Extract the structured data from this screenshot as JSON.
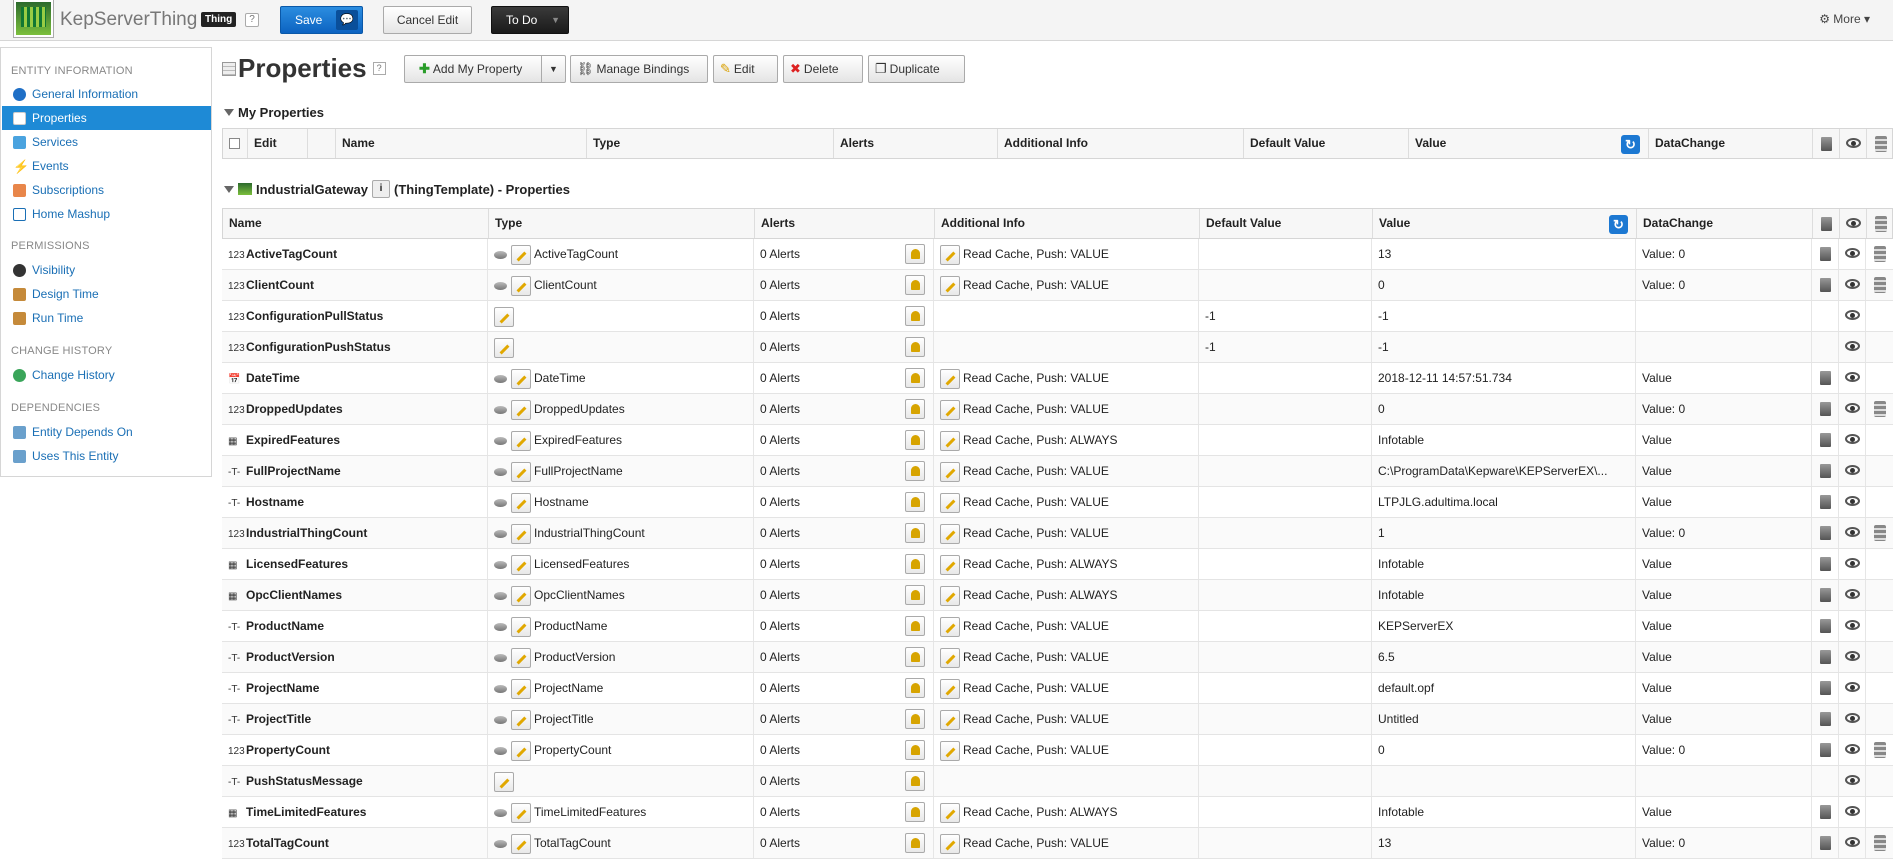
{
  "app": {
    "title": "KepServerThing",
    "badge": "Thing",
    "help": "?"
  },
  "toolbar": {
    "save": "Save",
    "cancel": "Cancel Edit",
    "todo": "To Do",
    "more": "More"
  },
  "sidebar": {
    "entity_info": "ENTITY INFORMATION",
    "entity_items": [
      "General Information",
      "Properties",
      "Services",
      "Events",
      "Subscriptions",
      "Home Mashup"
    ],
    "permissions": "PERMISSIONS",
    "perm_items": [
      "Visibility",
      "Design Time",
      "Run Time"
    ],
    "change_history": "CHANGE HISTORY",
    "history_items": [
      "Change History"
    ],
    "dependencies": "DEPENDENCIES",
    "dep_items": [
      "Entity Depends On",
      "Uses This Entity"
    ]
  },
  "page": {
    "title": "Properties",
    "buttons": {
      "add": "Add My Property",
      "bindings": "Manage Bindings",
      "edit": "Edit",
      "delete": "Delete",
      "duplicate": "Duplicate"
    }
  },
  "my_properties": {
    "title": "My Properties",
    "headers": {
      "edit": "Edit",
      "name": "Name",
      "type": "Type",
      "alerts": "Alerts",
      "info": "Additional Info",
      "default": "Default Value",
      "value": "Value",
      "datachange": "DataChange"
    }
  },
  "template": {
    "name": "IndustrialGateway",
    "suffix": "(ThingTemplate) - Properties"
  },
  "headers": {
    "name": "Name",
    "type": "Type",
    "alerts": "Alerts",
    "info": "Additional Info",
    "default": "Default Value",
    "value": "Value",
    "datachange": "DataChange"
  },
  "rows": [
    {
      "icon": "123",
      "name": "ActiveTagCount",
      "type": "ActiveTagCount",
      "alerts": "0 Alerts",
      "info": "Read Cache, Push: VALUE",
      "default": "",
      "value": "13",
      "dc": "Value: 0",
      "rt": true,
      "db": true
    },
    {
      "icon": "123",
      "name": "ClientCount",
      "type": "ClientCount",
      "alerts": "0 Alerts",
      "info": "Read Cache, Push: VALUE",
      "default": "",
      "value": "0",
      "dc": "Value: 0",
      "rt": true,
      "db": true
    },
    {
      "icon": "123",
      "name": "ConfigurationPullStatus",
      "type": "",
      "alerts": "0 Alerts",
      "info": "",
      "default": "-1",
      "value": "-1",
      "dc": "",
      "rt": false,
      "db": false
    },
    {
      "icon": "123",
      "name": "ConfigurationPushStatus",
      "type": "",
      "alerts": "0 Alerts",
      "info": "",
      "default": "-1",
      "value": "-1",
      "dc": "",
      "rt": false,
      "db": false
    },
    {
      "icon": "date",
      "name": "DateTime",
      "type": "DateTime",
      "alerts": "0 Alerts",
      "info": "Read Cache, Push: VALUE",
      "default": "",
      "value": "2018-12-11 14:57:51.734",
      "dc": "Value",
      "rt": true,
      "db": false
    },
    {
      "icon": "123",
      "name": "DroppedUpdates",
      "type": "DroppedUpdates",
      "alerts": "0 Alerts",
      "info": "Read Cache, Push: VALUE",
      "default": "",
      "value": "0",
      "dc": "Value: 0",
      "rt": true,
      "db": true
    },
    {
      "icon": "table",
      "name": "ExpiredFeatures",
      "type": "ExpiredFeatures",
      "alerts": "0 Alerts",
      "info": "Read Cache, Push: ALWAYS",
      "default": "",
      "value": "Infotable",
      "dc": "Value",
      "rt": true,
      "db": false
    },
    {
      "icon": "str",
      "name": "FullProjectName",
      "type": "FullProjectName",
      "alerts": "0 Alerts",
      "info": "Read Cache, Push: VALUE",
      "default": "",
      "value": "C:\\ProgramData\\Kepware\\KEPServerEX\\...",
      "dc": "Value",
      "rt": true,
      "db": false
    },
    {
      "icon": "str",
      "name": "Hostname",
      "type": "Hostname",
      "alerts": "0 Alerts",
      "info": "Read Cache, Push: VALUE",
      "default": "",
      "value": "LTPJLG.adultima.local",
      "dc": "Value",
      "rt": true,
      "db": false
    },
    {
      "icon": "123",
      "name": "IndustrialThingCount",
      "type": "IndustrialThingCount",
      "alerts": "0 Alerts",
      "info": "Read Cache, Push: VALUE",
      "default": "",
      "value": "1",
      "dc": "Value: 0",
      "rt": true,
      "db": true
    },
    {
      "icon": "table",
      "name": "LicensedFeatures",
      "type": "LicensedFeatures",
      "alerts": "0 Alerts",
      "info": "Read Cache, Push: ALWAYS",
      "default": "",
      "value": "Infotable",
      "dc": "Value",
      "rt": true,
      "db": false
    },
    {
      "icon": "table",
      "name": "OpcClientNames",
      "type": "OpcClientNames",
      "alerts": "0 Alerts",
      "info": "Read Cache, Push: ALWAYS",
      "default": "",
      "value": "Infotable",
      "dc": "Value",
      "rt": true,
      "db": false
    },
    {
      "icon": "str",
      "name": "ProductName",
      "type": "ProductName",
      "alerts": "0 Alerts",
      "info": "Read Cache, Push: VALUE",
      "default": "",
      "value": "KEPServerEX",
      "dc": "Value",
      "rt": true,
      "db": false
    },
    {
      "icon": "str",
      "name": "ProductVersion",
      "type": "ProductVersion",
      "alerts": "0 Alerts",
      "info": "Read Cache, Push: VALUE",
      "default": "",
      "value": "6.5",
      "dc": "Value",
      "rt": true,
      "db": false
    },
    {
      "icon": "str",
      "name": "ProjectName",
      "type": "ProjectName",
      "alerts": "0 Alerts",
      "info": "Read Cache, Push: VALUE",
      "default": "",
      "value": "default.opf",
      "dc": "Value",
      "rt": true,
      "db": false
    },
    {
      "icon": "str",
      "name": "ProjectTitle",
      "type": "ProjectTitle",
      "alerts": "0 Alerts",
      "info": "Read Cache, Push: VALUE",
      "default": "",
      "value": "Untitled",
      "dc": "Value",
      "rt": true,
      "db": false
    },
    {
      "icon": "123",
      "name": "PropertyCount",
      "type": "PropertyCount",
      "alerts": "0 Alerts",
      "info": "Read Cache, Push: VALUE",
      "default": "",
      "value": "0",
      "dc": "Value: 0",
      "rt": true,
      "db": true
    },
    {
      "icon": "str",
      "name": "PushStatusMessage",
      "type": "",
      "alerts": "0 Alerts",
      "info": "",
      "default": "",
      "value": "",
      "dc": "",
      "rt": false,
      "db": false
    },
    {
      "icon": "table",
      "name": "TimeLimitedFeatures",
      "type": "TimeLimitedFeatures",
      "alerts": "0 Alerts",
      "info": "Read Cache, Push: ALWAYS",
      "default": "",
      "value": "Infotable",
      "dc": "Value",
      "rt": true,
      "db": false
    },
    {
      "icon": "123",
      "name": "TotalTagCount",
      "type": "TotalTagCount",
      "alerts": "0 Alerts",
      "info": "Read Cache, Push: VALUE",
      "default": "",
      "value": "13",
      "dc": "Value: 0",
      "rt": true,
      "db": true
    }
  ]
}
